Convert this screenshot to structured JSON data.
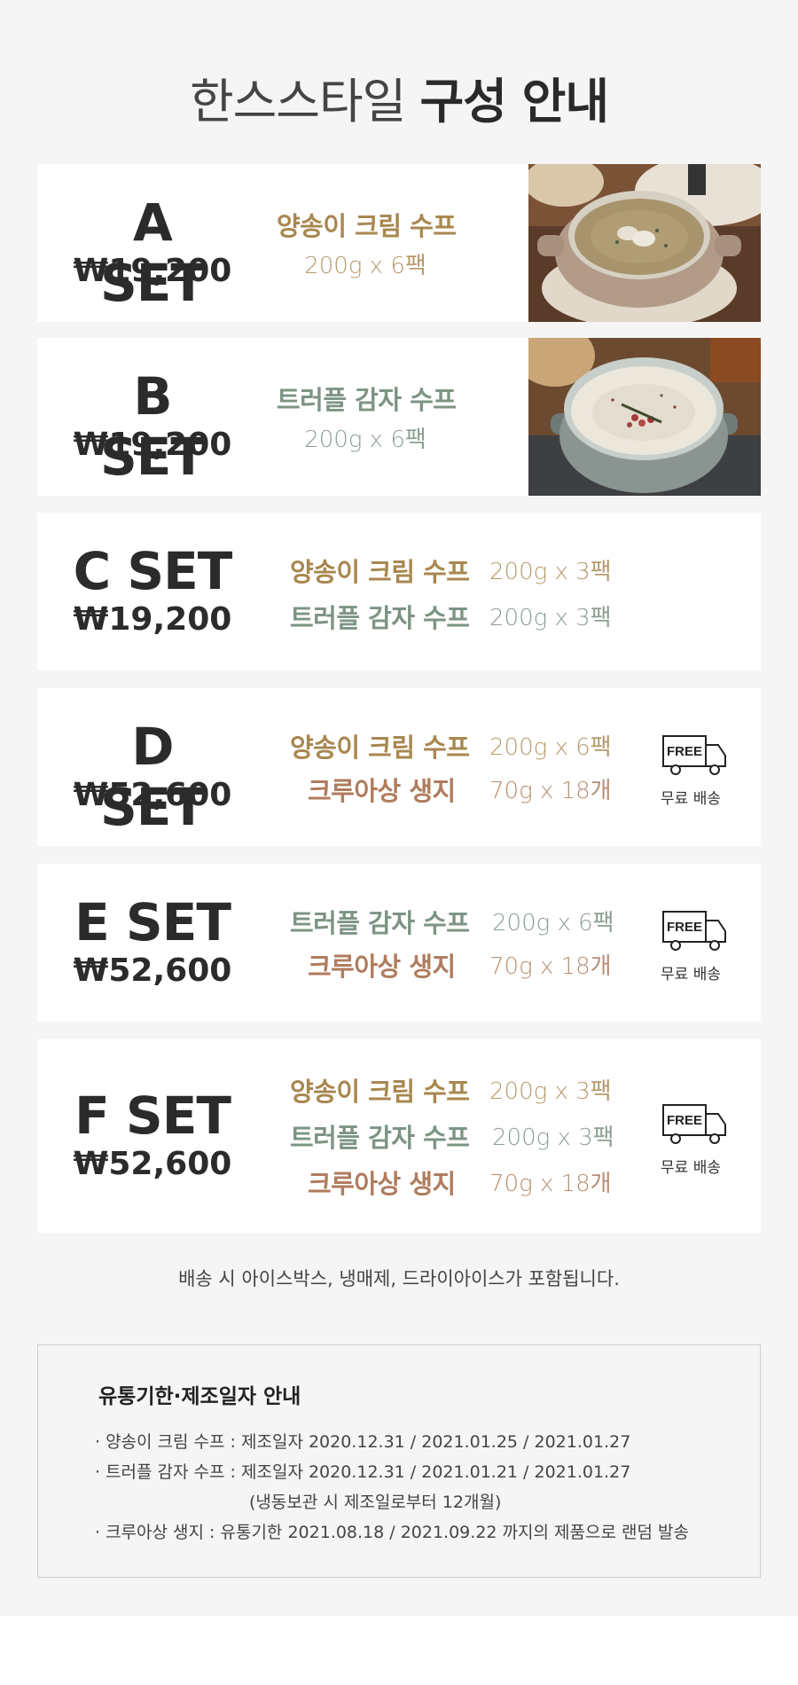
{
  "title": {
    "light": "한스스타일",
    "bold": "구성 안내"
  },
  "sets": [
    {
      "name": "A SET",
      "price": "₩19,200",
      "items": [
        {
          "name": "양송이 크림 수프",
          "qty": "200g x 6팩",
          "kind": "onion"
        }
      ],
      "photo": "mushroom-soup-photo",
      "free_shipping": false
    },
    {
      "name": "B SET",
      "price": "₩19,200",
      "items": [
        {
          "name": "트러플 감자 수프",
          "qty": "200g x 6팩",
          "kind": "truffle"
        }
      ],
      "photo": "truffle-soup-photo",
      "free_shipping": false
    },
    {
      "name": "C SET",
      "price": "₩19,200",
      "items": [
        {
          "name": "양송이 크림 수프",
          "qty": "200g x 3팩",
          "kind": "onion"
        },
        {
          "name": "트러플 감자 수프",
          "qty": "200g x 3팩",
          "kind": "truffle"
        }
      ],
      "free_shipping": false
    },
    {
      "name": "D SET",
      "price": "₩52,600",
      "items": [
        {
          "name": "양송이 크림 수프",
          "qty": "200g x 6팩",
          "kind": "onion"
        },
        {
          "name": "크루아상 생지",
          "qty": "70g x 18개",
          "kind": "croissant"
        }
      ],
      "free_shipping": true
    },
    {
      "name": "E SET",
      "price": "₩52,600",
      "items": [
        {
          "name": "트러플 감자 수프",
          "qty": "200g x 6팩",
          "kind": "truffle"
        },
        {
          "name": "크루아상 생지",
          "qty": "70g x 18개",
          "kind": "croissant"
        }
      ],
      "free_shipping": true
    },
    {
      "name": "F SET",
      "price": "₩52,600",
      "items": [
        {
          "name": "양송이 크림 수프",
          "qty": "200g x 3팩",
          "kind": "onion"
        },
        {
          "name": "트러플 감자 수프",
          "qty": "200g x 3팩",
          "kind": "truffle"
        },
        {
          "name": "크루아상 생지",
          "qty": "70g x 18개",
          "kind": "croissant"
        }
      ],
      "free_shipping": true
    }
  ],
  "free_badge": {
    "icon_text": "FREE",
    "label": "무료 배송",
    "icon": "delivery-truck-icon"
  },
  "note": "배송 시 아이스박스, 냉매제, 드라이아이스가 포함됩니다.",
  "info": {
    "heading": "유통기한·제조일자 안내",
    "lines": [
      "· 양송이 크림 수프 : 제조일자 2020.12.31 / 2021.01.25 / 2021.01.27",
      "· 트러플 감자 수프 : 제조일자 2020.12.31 / 2021.01.21 / 2021.01.27",
      "(냉동보관 시 제조일로부터 12개월)",
      "· 크루아상 생지 : 유통기한 2021.08.18 / 2021.09.22 까지의 제품으로 랜덤 발송"
    ]
  },
  "colors": {
    "background": "#f5f5f5",
    "card": "#ffffff",
    "onion": "#a8874f",
    "truffle": "#7d9484",
    "croissant": "#b07c5e",
    "text_dark": "#2b2b2b"
  }
}
